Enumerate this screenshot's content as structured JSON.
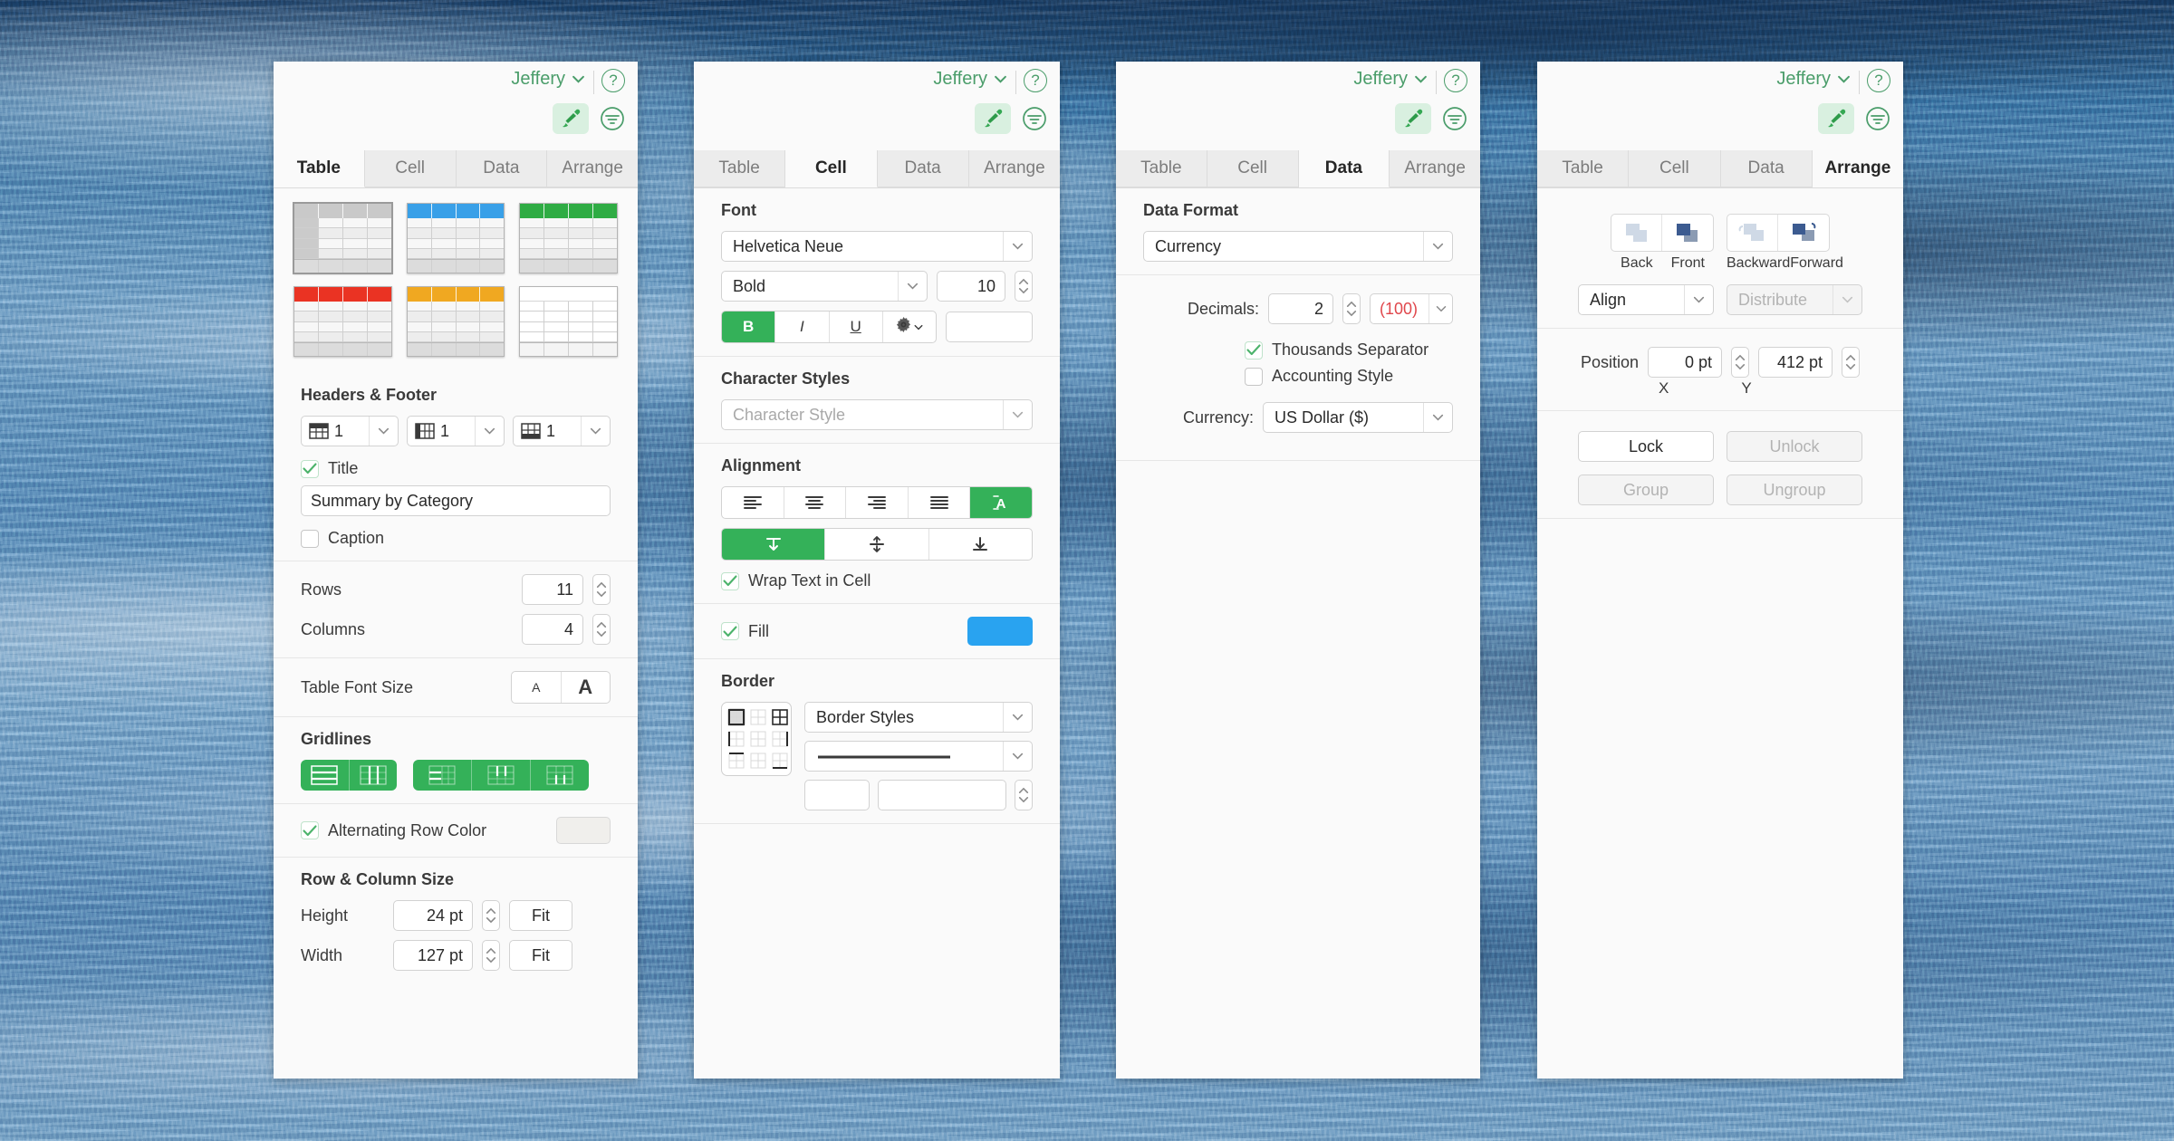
{
  "account": {
    "name": "Jeffery",
    "help_icon": "help-circle-icon",
    "chevron_icon": "chevron-down-icon"
  },
  "toolbar": {
    "format_brush_icon": "paint-brush-icon",
    "format_panel_icon": "format-filter-icon"
  },
  "tabs": [
    "Table",
    "Cell",
    "Data",
    "Arrange"
  ],
  "panels": [
    {
      "active_tab": "Table"
    },
    {
      "active_tab": "Cell"
    },
    {
      "active_tab": "Data"
    },
    {
      "active_tab": "Arrange"
    }
  ],
  "table_tab": {
    "styles": [
      {
        "name": "gray",
        "header": "#c9c9c9",
        "selected": true
      },
      {
        "name": "blue",
        "header": "#39a0e8",
        "selected": false
      },
      {
        "name": "green",
        "header": "#2fac44",
        "selected": false
      },
      {
        "name": "red",
        "header": "#ea3323",
        "selected": false
      },
      {
        "name": "orange",
        "header": "#f0a821",
        "selected": false
      },
      {
        "name": "plain",
        "header": "#ffffff",
        "selected": false
      }
    ],
    "headers_footer": {
      "title": "Headers & Footer",
      "header_rows": {
        "icon": "header-rows-icon",
        "value": "1"
      },
      "header_columns": {
        "icon": "header-columns-icon",
        "value": "1"
      },
      "footer_rows": {
        "icon": "footer-rows-icon",
        "value": "1"
      },
      "title_checkbox": {
        "label": "Title",
        "checked": true
      },
      "title_value": "Summary by Category",
      "caption_checkbox": {
        "label": "Caption",
        "checked": false
      }
    },
    "rows": {
      "label": "Rows",
      "value": "11"
    },
    "columns": {
      "label": "Columns",
      "value": "4"
    },
    "font_size": {
      "label": "Table Font Size",
      "smaller": "A",
      "larger": "A"
    },
    "gridlines": {
      "title": "Gridlines",
      "group_a": [
        "header-horizontal-gridlines-icon",
        "header-vertical-gridlines-icon"
      ],
      "group_b": [
        "body-horizontal-gridlines-icon",
        "body-vertical-gridlines-icon",
        "body-all-gridlines-icon"
      ]
    },
    "alternating": {
      "label": "Alternating Row Color",
      "checked": true,
      "color": "#f0efec"
    },
    "row_col_size": {
      "title": "Row & Column Size",
      "height": {
        "label": "Height",
        "value": "24 pt",
        "fit": "Fit"
      },
      "width": {
        "label": "Width",
        "value": "127 pt",
        "fit": "Fit"
      }
    }
  },
  "cell_tab": {
    "font": {
      "title": "Font",
      "family": "Helvetica Neue",
      "weight": "Bold",
      "size": "10",
      "bold": {
        "label": "B",
        "active": true
      },
      "italic": {
        "label": "I",
        "active": false
      },
      "underline": {
        "label": "U",
        "active": false
      },
      "options_icon": "gear-icon",
      "color": "#ffffff"
    },
    "character_styles": {
      "title": "Character Styles",
      "placeholder": "Character Style"
    },
    "alignment": {
      "title": "Alignment",
      "horizontal": [
        {
          "icon": "align-left-icon",
          "active": false
        },
        {
          "icon": "align-center-icon",
          "active": false
        },
        {
          "icon": "align-right-icon",
          "active": false
        },
        {
          "icon": "align-justify-icon",
          "active": false
        },
        {
          "icon": "align-auto-icon",
          "active": true
        }
      ],
      "vertical": [
        {
          "icon": "align-top-icon",
          "active": true
        },
        {
          "icon": "align-middle-icon",
          "active": false
        },
        {
          "icon": "align-bottom-icon",
          "active": false
        }
      ],
      "wrap": {
        "label": "Wrap Text in Cell",
        "checked": true
      }
    },
    "fill": {
      "label": "Fill",
      "checked": true,
      "color": "#29a3f0"
    },
    "border": {
      "title": "Border",
      "styles_label": "Border Styles",
      "line_preview": "solid-line-icon",
      "color": "#ffffff",
      "width_value": "",
      "picker_selected_index": 0
    }
  },
  "data_tab": {
    "data_format": {
      "title": "Data Format",
      "value": "Currency"
    },
    "decimals": {
      "label": "Decimals:",
      "value": "2"
    },
    "negative_style": {
      "value": "(100)",
      "color": "#e0474c"
    },
    "thousands": {
      "label": "Thousands Separator",
      "checked": true
    },
    "accounting": {
      "label": "Accounting Style",
      "checked": false
    },
    "currency": {
      "label": "Currency:",
      "value": "US Dollar ($)"
    }
  },
  "arrange_tab": {
    "order": [
      {
        "label": "Back",
        "icon": "send-to-back-icon",
        "enabled": false
      },
      {
        "label": "Front",
        "icon": "bring-to-front-icon",
        "enabled": true
      },
      {
        "label": "Backward",
        "icon": "send-backward-icon",
        "enabled": false
      },
      {
        "label": "Forward",
        "icon": "bring-forward-icon",
        "enabled": true
      }
    ],
    "align": {
      "label": "Align",
      "enabled": true
    },
    "distribute": {
      "label": "Distribute",
      "enabled": false
    },
    "position": {
      "label": "Position",
      "x": {
        "value": "0 pt",
        "axis": "X"
      },
      "y": {
        "value": "412 pt",
        "axis": "Y"
      }
    },
    "lock": {
      "label": "Lock",
      "enabled": true
    },
    "unlock": {
      "label": "Unlock",
      "enabled": false
    },
    "group": {
      "label": "Group",
      "enabled": false
    },
    "ungroup": {
      "label": "Ungroup",
      "enabled": false
    }
  }
}
